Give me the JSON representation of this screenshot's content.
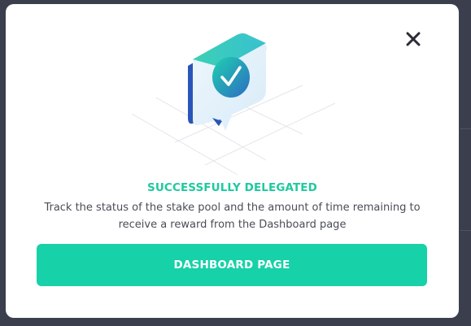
{
  "modal": {
    "close_icon": "close-icon",
    "illustration_icon": "check-badge-icon",
    "title": "SUCCESSFULLY DELEGATED",
    "description": "Track the status of the stake pool and the amount of time remaining to receive a reward from the Dashboard page",
    "cta_label": "DASHBOARD PAGE"
  },
  "colors": {
    "accent": "#17d1a8",
    "title": "#1fc9a0",
    "backdrop": "#3b3e4c",
    "modal_bg": "#ffffff",
    "text": "#4a4d57"
  }
}
